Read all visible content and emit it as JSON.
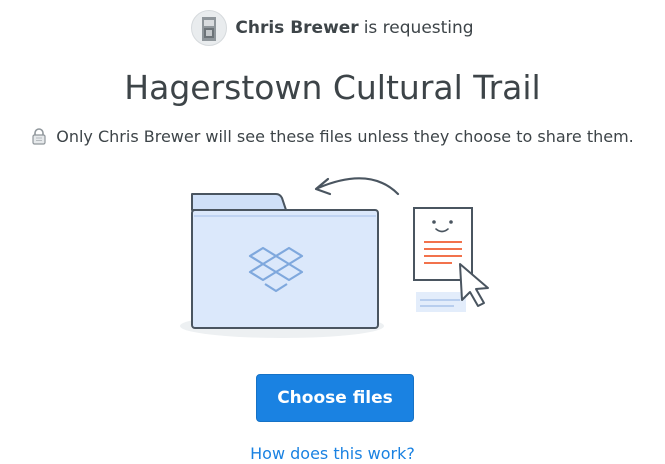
{
  "request": {
    "requester_name": "Chris Brewer",
    "requesting_text": "is requesting",
    "title": "Hagerstown Cultural Trail",
    "privacy_text": "Only Chris Brewer will see these files unless they choose to share them."
  },
  "actions": {
    "choose_files_label": "Choose files",
    "help_link_label": "How does this work?"
  },
  "icons": {
    "avatar": "avatar-photo",
    "privacy": "lock-icon",
    "illustration": "folder-upload-illustration"
  },
  "colors": {
    "accent": "#1a82e2",
    "text": "#3d4448",
    "folder_fill": "#dbe8fb",
    "document_lines": "#f2724c"
  }
}
